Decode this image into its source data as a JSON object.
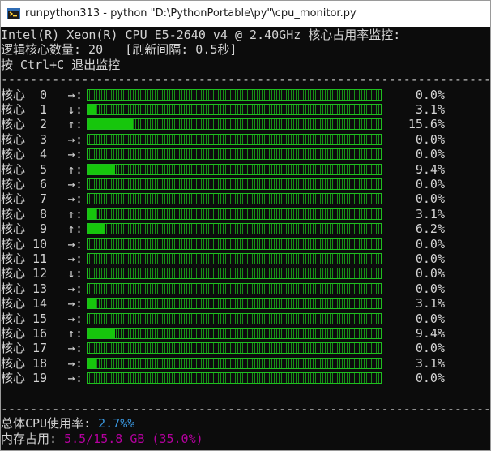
{
  "window": {
    "title": "runpython313 - python   \"D:\\PythonPortable\\py\"\\cpu_monitor.py"
  },
  "header": {
    "line1": "Intel(R) Xeon(R) CPU E5-2640 v4 @ 2.40GHz 核心占用率监控:",
    "line2": "逻辑核心数量: 20   [刷新间隔: 0.5秒]",
    "line3": "按 Ctrl+C 退出监控"
  },
  "separator": "------------------------------------------------------------------------------------------",
  "cores": [
    {
      "label": "核心  0",
      "arrow": "→",
      "value": 0.0,
      "percent": "0.0%"
    },
    {
      "label": "核心  1",
      "arrow": "↓",
      "value": 3.1,
      "percent": "3.1%"
    },
    {
      "label": "核心  2",
      "arrow": "↑",
      "value": 15.6,
      "percent": "15.6%"
    },
    {
      "label": "核心  3",
      "arrow": "→",
      "value": 0.0,
      "percent": "0.0%"
    },
    {
      "label": "核心  4",
      "arrow": "→",
      "value": 0.0,
      "percent": "0.0%"
    },
    {
      "label": "核心  5",
      "arrow": "↑",
      "value": 9.4,
      "percent": "9.4%"
    },
    {
      "label": "核心  6",
      "arrow": "→",
      "value": 0.0,
      "percent": "0.0%"
    },
    {
      "label": "核心  7",
      "arrow": "→",
      "value": 0.0,
      "percent": "0.0%"
    },
    {
      "label": "核心  8",
      "arrow": "↑",
      "value": 3.1,
      "percent": "3.1%"
    },
    {
      "label": "核心  9",
      "arrow": "↑",
      "value": 6.2,
      "percent": "6.2%"
    },
    {
      "label": "核心 10",
      "arrow": "→",
      "value": 0.0,
      "percent": "0.0%"
    },
    {
      "label": "核心 11",
      "arrow": "→",
      "value": 0.0,
      "percent": "0.0%"
    },
    {
      "label": "核心 12",
      "arrow": "↓",
      "value": 0.0,
      "percent": "0.0%"
    },
    {
      "label": "核心 13",
      "arrow": "→",
      "value": 0.0,
      "percent": "0.0%"
    },
    {
      "label": "核心 14",
      "arrow": "→",
      "value": 3.1,
      "percent": "3.1%"
    },
    {
      "label": "核心 15",
      "arrow": "→",
      "value": 0.0,
      "percent": "0.0%"
    },
    {
      "label": "核心 16",
      "arrow": "↑",
      "value": 9.4,
      "percent": "9.4%"
    },
    {
      "label": "核心 17",
      "arrow": "→",
      "value": 0.0,
      "percent": "0.0%"
    },
    {
      "label": "核心 18",
      "arrow": "→",
      "value": 3.1,
      "percent": "3.1%"
    },
    {
      "label": "核心 19",
      "arrow": "→",
      "value": 0.0,
      "percent": "0.0%"
    }
  ],
  "summary": {
    "total_label": "总体CPU使用率: ",
    "total_value": "2.7%%",
    "memory_label": "内存占用: ",
    "memory_value": "5.5/15.8 GB (35.0%)"
  },
  "colors": {
    "background": "#0c0c0c",
    "text": "#d4d4d4",
    "bar_green": "#16c60c",
    "total_blue": "#3a96dd",
    "memory_magenta": "#b4009e"
  },
  "icons": {
    "app": "python-console-icon"
  }
}
